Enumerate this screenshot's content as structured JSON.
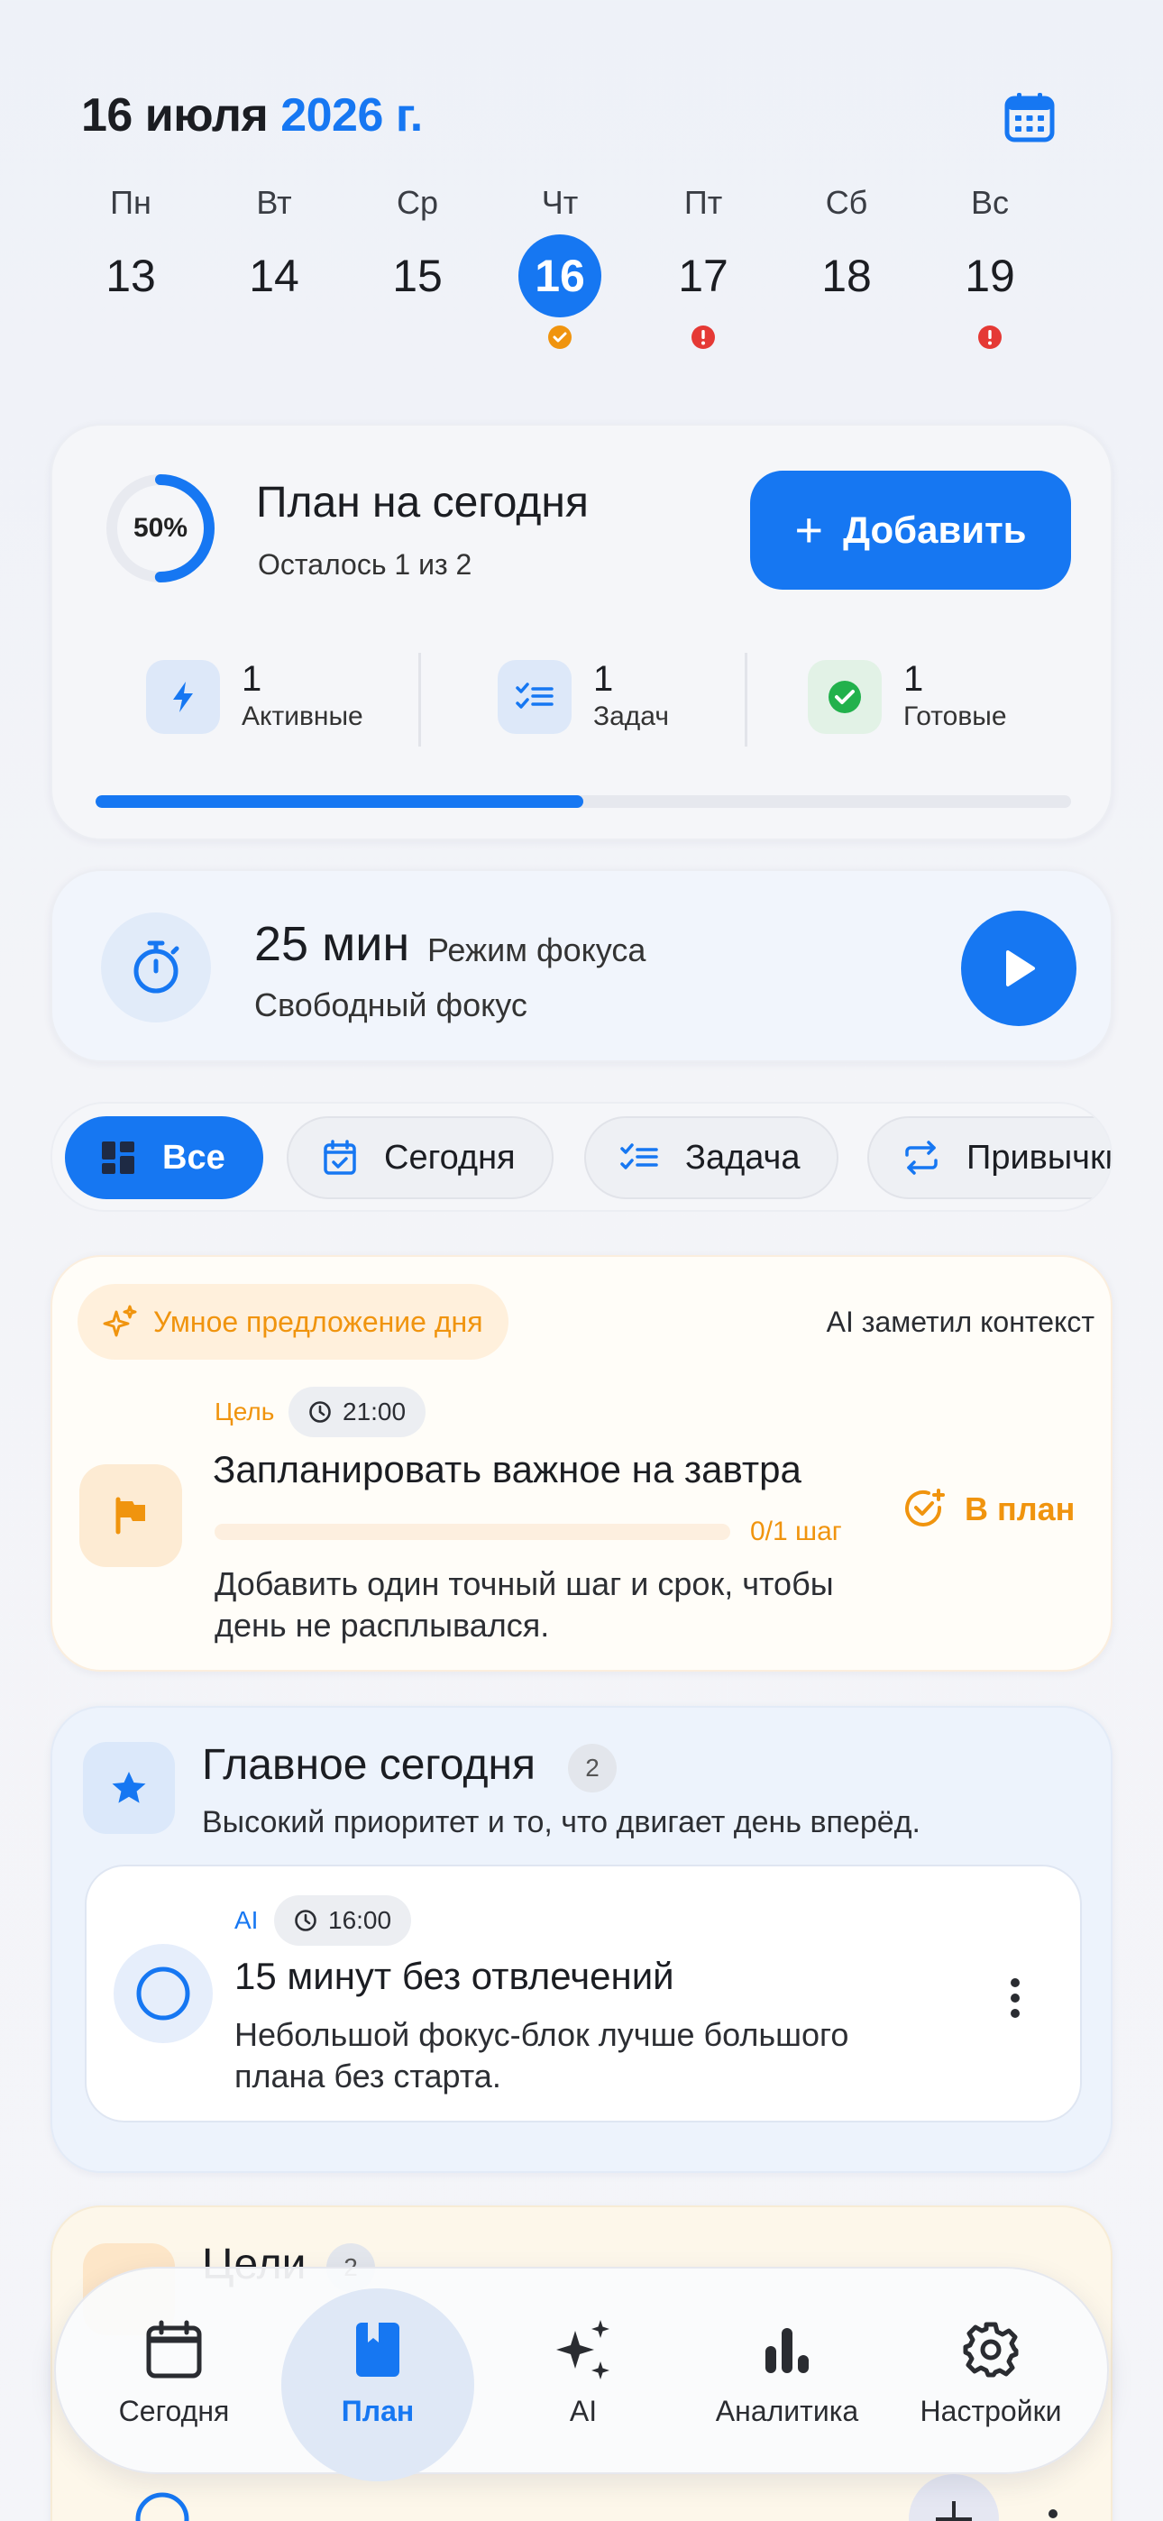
{
  "header": {
    "date_text": "16 июля",
    "year_text": "2026 г."
  },
  "week": [
    {
      "name": "Пн",
      "num": "13",
      "mark": "none"
    },
    {
      "name": "Вт",
      "num": "14",
      "mark": "none"
    },
    {
      "name": "Ср",
      "num": "15",
      "mark": "none"
    },
    {
      "name": "Чт",
      "num": "16",
      "mark": "check",
      "active": true
    },
    {
      "name": "Пт",
      "num": "17",
      "mark": "alert"
    },
    {
      "name": "Сб",
      "num": "18",
      "mark": "none"
    },
    {
      "name": "Вс",
      "num": "19",
      "mark": "alert"
    }
  ],
  "plan": {
    "percent_label": "50%",
    "percent": 50,
    "title": "План на сегодня",
    "subtitle": "Осталось 1 из 2",
    "add_label": "Добавить",
    "stats": [
      {
        "value": "1",
        "label": "Активные",
        "icon": "bolt-icon"
      },
      {
        "value": "1",
        "label": "Задач",
        "icon": "checklist-icon"
      },
      {
        "value": "1",
        "label": "Готовые",
        "icon": "check-circle-icon"
      }
    ],
    "progress": 0.5
  },
  "focus": {
    "minutes": "25 мин",
    "mode": "Режим фокуса",
    "free": "Свободный фокус"
  },
  "filters": [
    {
      "label": "Все",
      "icon": "grid-icon",
      "active": true
    },
    {
      "label": "Сегодня",
      "icon": "calendar-check-icon"
    },
    {
      "label": "Задача",
      "icon": "checklist-icon"
    },
    {
      "label": "Привычки",
      "icon": "repeat-icon"
    }
  ],
  "suggestion": {
    "badge": "Умное предложение дня",
    "context": "AI заметил контекст",
    "tag": "Цель",
    "time": "21:00",
    "title": "Запланировать важное на завтра",
    "steps": "0/1 шаг",
    "description": "Добавить один точный шаг и срок, чтобы день не расплывался.",
    "action": "В план"
  },
  "main_today": {
    "title": "Главное сегодня",
    "count": "2",
    "subtitle": "Высокий приоритет и то, что двигает день вперёд.",
    "task": {
      "tag": "AI",
      "time": "16:00",
      "title": "15 минут без отвлечений",
      "description": "Небольшой фокус-блок лучше большого плана без старта."
    }
  },
  "goals": {
    "title": "Цели",
    "count": "2"
  },
  "nav": [
    {
      "label": "Сегодня",
      "icon": "calendar-icon"
    },
    {
      "label": "План",
      "icon": "book-icon",
      "active": true
    },
    {
      "label": "AI",
      "icon": "sparkles-icon"
    },
    {
      "label": "Аналитика",
      "icon": "bar-chart-icon"
    },
    {
      "label": "Настройки",
      "icon": "gear-icon"
    }
  ],
  "colors": {
    "accent": "#1677f2",
    "orange": "#f0940e",
    "alert": "#e53935",
    "success": "#22b14c"
  }
}
